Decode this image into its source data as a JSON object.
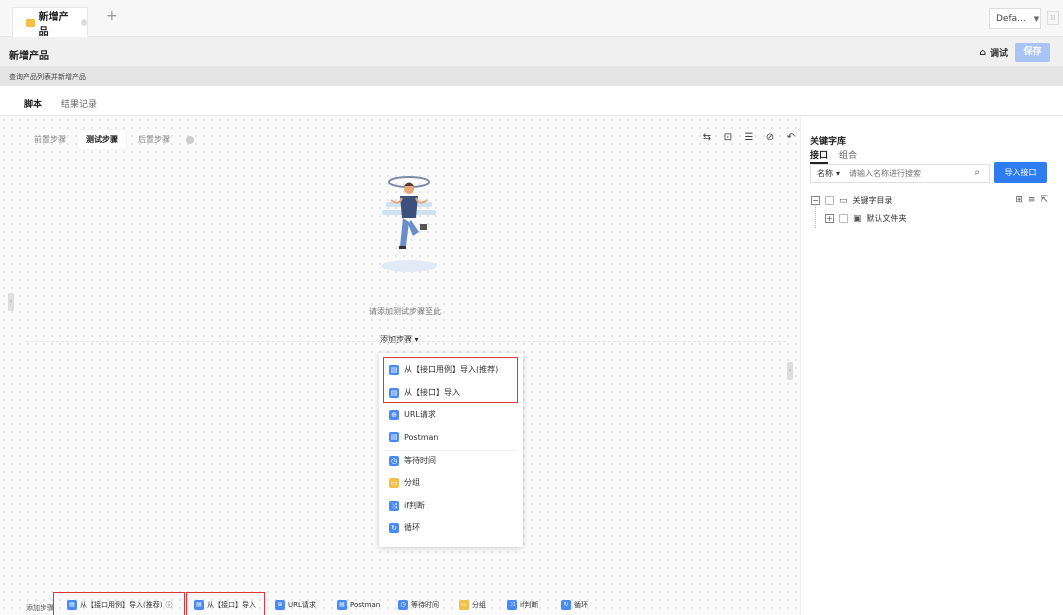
{
  "tab": {
    "label": "新增产品"
  },
  "env_select": {
    "value": "Defa..."
  },
  "header": {
    "title": "新增产品",
    "debug_label": "调试",
    "save_label": "保存"
  },
  "description": "查询产品列表并新增产品",
  "main_tabs": [
    {
      "label": "脚本"
    },
    {
      "label": "结果记录"
    }
  ],
  "step_tabs": [
    {
      "label": "前置步骤"
    },
    {
      "label": "测试步骤"
    },
    {
      "label": "后置步骤"
    }
  ],
  "canvas": {
    "empty_text": "请添加测试步骤至此",
    "add_step_label": "添加步骤"
  },
  "dropdown": {
    "items": [
      {
        "label": "从【接口用例】导入(推荐)",
        "icon": "import-icon",
        "color": "#4a8af4"
      },
      {
        "label": "从【接口】导入",
        "icon": "import-icon",
        "color": "#4a8af4"
      },
      {
        "label": "URL请求",
        "icon": "link-icon",
        "color": "#4a8af4"
      },
      {
        "label": "Postman",
        "icon": "postman-icon",
        "color": "#4a8af4"
      },
      {
        "label": "等待时间",
        "icon": "clock-icon",
        "color": "#4a8af4"
      },
      {
        "label": "分组",
        "icon": "group-icon",
        "color": "#f4c04a"
      },
      {
        "label": "if判断",
        "icon": "branch-icon",
        "color": "#4a8af4"
      },
      {
        "label": "循环",
        "icon": "loop-icon",
        "color": "#4a8af4"
      }
    ]
  },
  "bottom_bar": {
    "label": "添加步骤",
    "items": [
      {
        "label": "从【接口用例】导入(推荐)",
        "color": "#4a8af4"
      },
      {
        "label": "从【接口】导入",
        "color": "#4a8af4"
      },
      {
        "label": "URL请求",
        "color": "#4a8af4"
      },
      {
        "label": "Postman",
        "color": "#4a8af4"
      },
      {
        "label": "等待时间",
        "color": "#4a8af4"
      },
      {
        "label": "分组",
        "color": "#f4c04a"
      },
      {
        "label": "if判断",
        "color": "#4a8af4"
      },
      {
        "label": "循环",
        "color": "#4a8af4"
      }
    ]
  },
  "right_panel": {
    "title": "关键字库",
    "tabs": [
      {
        "label": "接口"
      },
      {
        "label": "组合"
      }
    ],
    "search_field": "名称",
    "search_placeholder": "请输入名称进行搜索",
    "import_label": "导入接口",
    "tree": [
      {
        "label": "关键字目录"
      },
      {
        "label": "默认文件夹"
      }
    ]
  },
  "colors": {
    "accent": "#2f7cf0",
    "highlight": "#e0353b",
    "tab_icon": "#f4c04a"
  }
}
